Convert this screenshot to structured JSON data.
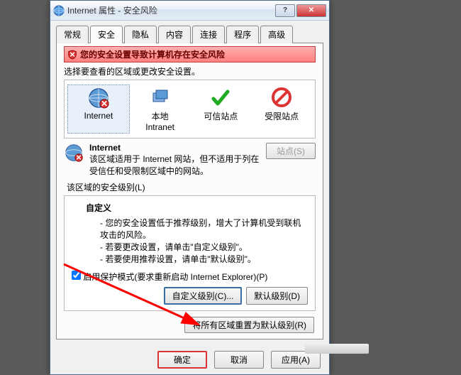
{
  "window": {
    "title": "Internet 属性 - 安全风险"
  },
  "tabs": [
    "常规",
    "安全",
    "隐私",
    "内容",
    "连接",
    "程序",
    "高级"
  ],
  "active_tab": 1,
  "warning": "您的安全设置导致计算机存在安全风险",
  "zone_prompt": "选择要查看的区域或更改安全设置。",
  "zones": {
    "internet": "Internet",
    "intranet": "本地\nIntranet",
    "trusted": "可信站点",
    "restricted": "受限站点"
  },
  "zone_desc": {
    "name": "Internet",
    "text": "该区域适用于 Internet 网站，但不适用于列在受信任和受限制区域中的网站。",
    "sites_btn": "站点(S)"
  },
  "level_label": "该区域的安全级别(L)",
  "level": {
    "title": "自定义",
    "lines": [
      "您的安全设置低于推荐级别，增大了计算机受到联机攻击的风险。",
      "若要更改设置，请单击\"自定义级别\"。",
      "若要使用推荐设置，请单击\"默认级别\"。"
    ]
  },
  "protect_mode": "启用保护模式(要求重新启动 Internet Explorer)(P)",
  "custom_btn": "自定义级别(C)...",
  "default_btn": "默认级别(D)",
  "reset_btn": "将所有区域重置为默认级别(R)",
  "dialog": {
    "ok": "确定",
    "cancel": "取消",
    "apply": "应用(A)"
  }
}
